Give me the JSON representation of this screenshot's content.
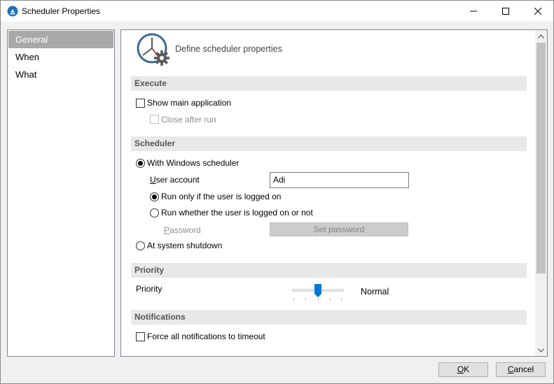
{
  "window": {
    "title": "Scheduler Properties",
    "minimize_glyph": "—",
    "maximize_glyph": "☐",
    "close_glyph": "✕"
  },
  "sidebar": {
    "items": [
      {
        "label": "General",
        "selected": true
      },
      {
        "label": "When",
        "selected": false
      },
      {
        "label": "What",
        "selected": false
      }
    ]
  },
  "header": {
    "icon": "clock-gear-icon",
    "text": "Define scheduler properties"
  },
  "execute": {
    "section_title": "Execute",
    "show_main_app": {
      "label": "Show main application",
      "checked": false
    },
    "close_after_run": {
      "label": "Close after run",
      "checked": false,
      "enabled": false
    }
  },
  "scheduler": {
    "section_title": "Scheduler",
    "with_windows": {
      "label": "With Windows scheduler",
      "checked": true
    },
    "user_account_label_u": "U",
    "user_account_label_rest": "ser account",
    "user_account_value": "Adi",
    "run_only_logged_on": {
      "label": "Run only if the user is logged on",
      "checked": true
    },
    "run_whether": {
      "label": "Run whether the user is logged on or not",
      "checked": false
    },
    "password_label_u": "P",
    "password_label_rest": "assword",
    "set_password_label": "Set password",
    "at_shutdown": {
      "label": "At system shutdown",
      "checked": false
    }
  },
  "priority": {
    "section_title": "Priority",
    "label": "Priority",
    "value_text": "Normal",
    "slider_level": 0.5
  },
  "notifications": {
    "section_title": "Notifications",
    "force_timeout": {
      "label": "Force all notifications to timeout",
      "checked": false
    }
  },
  "buttons": {
    "ok_u": "O",
    "ok_rest": "K",
    "cancel_u": "C",
    "cancel_rest": "ancel"
  },
  "colors": {
    "accent": "#0078d7",
    "selection": "#a8a8a8",
    "section_bg": "#e8e8e8"
  }
}
